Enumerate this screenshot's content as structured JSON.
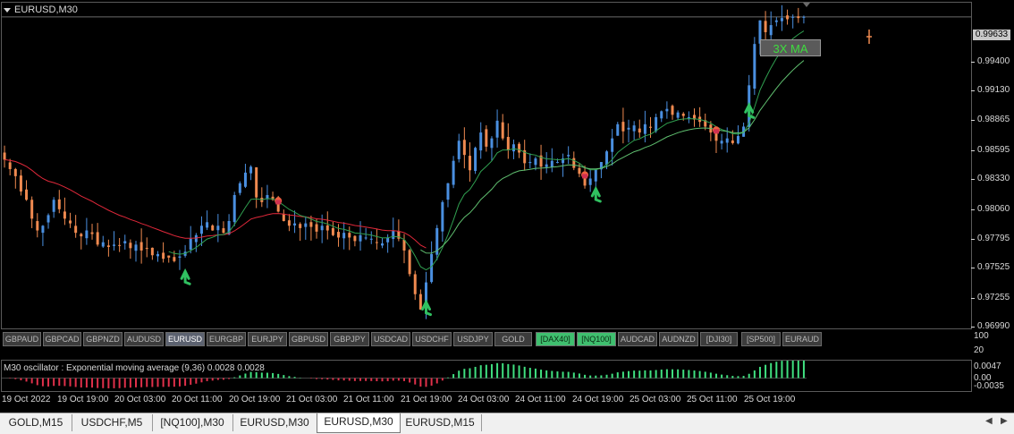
{
  "window": {
    "title": "EURUSD,M30"
  },
  "price_axis": {
    "ticks": [
      "0.99633",
      "0.99400",
      "0.99130",
      "0.98865",
      "0.98595",
      "0.98330",
      "0.98060",
      "0.97795",
      "0.97525",
      "0.97255",
      "0.96990"
    ],
    "current": "0.99633"
  },
  "ma_label": "3X MA",
  "symbol_bar": [
    {
      "label": "GBPAUD",
      "state": "normal"
    },
    {
      "label": "GBPCAD",
      "state": "normal"
    },
    {
      "label": "GBPNZD",
      "state": "normal"
    },
    {
      "label": "AUDUSD",
      "state": "normal"
    },
    {
      "label": "EURUSD",
      "state": "active"
    },
    {
      "label": "EURGBP",
      "state": "normal"
    },
    {
      "label": "EURJPY",
      "state": "normal"
    },
    {
      "label": "GBPUSD",
      "state": "normal"
    },
    {
      "label": "GBPJPY",
      "state": "normal"
    },
    {
      "label": "USDCAD",
      "state": "normal"
    },
    {
      "label": "USDCHF",
      "state": "normal"
    },
    {
      "label": "USDJPY",
      "state": "normal"
    },
    {
      "label": "GOLD",
      "state": "normal"
    },
    {
      "label": "[DAX40]",
      "state": "green"
    },
    {
      "label": "[NQ100]",
      "state": "green"
    },
    {
      "label": "AUDCAD",
      "state": "normal"
    },
    {
      "label": "AUDNZD",
      "state": "normal"
    },
    {
      "label": "[DJI30]",
      "state": "normal"
    },
    {
      "label": "[SP500]",
      "state": "normal"
    },
    {
      "label": "EURAUD",
      "state": "normal"
    }
  ],
  "indicator_axis": {
    "top": "100",
    "bottom": "20"
  },
  "oscillator": {
    "title": "M30  oscillator : Exponential moving average (9,36)  0.0028 0.0028",
    "axis": [
      "0.0047",
      "0.00",
      "-0.0035"
    ]
  },
  "time_axis": [
    "19 Oct 2022",
    "19 Oct 19:00",
    "20 Oct 03:00",
    "20 Oct 11:00",
    "20 Oct 19:00",
    "21 Oct 03:00",
    "21 Oct 11:00",
    "21 Oct 19:00",
    "24 Oct 03:00",
    "24 Oct 11:00",
    "24 Oct 19:00",
    "25 Oct 03:00",
    "25 Oct 11:00",
    "25 Oct 19:00"
  ],
  "tabs": [
    {
      "label": "GOLD,M15",
      "active": false
    },
    {
      "label": "USDCHF,M5",
      "active": false
    },
    {
      "label": "[NQ100],M30",
      "active": false
    },
    {
      "label": "EURUSD,M30",
      "active": false
    },
    {
      "label": "EURUSD,M30",
      "active": true
    },
    {
      "label": "EURUSD,M15",
      "active": false
    }
  ],
  "colors": {
    "bull": "#4a8fe0",
    "bear": "#f08a50",
    "ma_red": "#e0283a",
    "ma_green": "#30c060",
    "osc_pos": "#40e080",
    "osc_neg": "#e0304a"
  },
  "chart_data": {
    "type": "candlestick",
    "symbol": "EURUSD",
    "timeframe": "M30",
    "ylim": [
      0.9699,
      0.9975
    ],
    "closes": [
      0.9842,
      0.9834,
      0.9828,
      0.9815,
      0.9808,
      0.9792,
      0.9782,
      0.9786,
      0.9795,
      0.9808,
      0.98,
      0.9792,
      0.9788,
      0.978,
      0.9777,
      0.9782,
      0.9779,
      0.977,
      0.9772,
      0.9768,
      0.977,
      0.9769,
      0.9773,
      0.9767,
      0.977,
      0.9765,
      0.9767,
      0.9761,
      0.9762,
      0.9758,
      0.9759,
      0.9756,
      0.976,
      0.9764,
      0.9775,
      0.9778,
      0.9786,
      0.9789,
      0.9782,
      0.9786,
      0.978,
      0.979,
      0.9812,
      0.9822,
      0.9831,
      0.9836,
      0.981,
      0.9806,
      0.9812,
      0.9808,
      0.9798,
      0.979,
      0.9786,
      0.9788,
      0.9784,
      0.9788,
      0.9785,
      0.9781,
      0.9786,
      0.9782,
      0.9778,
      0.9776,
      0.978,
      0.9776,
      0.9773,
      0.9778,
      0.9776,
      0.9775,
      0.9772,
      0.9771,
      0.9776,
      0.9782,
      0.9775,
      0.9765,
      0.9745,
      0.9728,
      0.9715,
      0.9738,
      0.9762,
      0.9784,
      0.9806,
      0.9822,
      0.9841,
      0.9858,
      0.9846,
      0.9833,
      0.9852,
      0.9865,
      0.9853,
      0.986,
      0.9875,
      0.986,
      0.985,
      0.9855,
      0.9848,
      0.9839,
      0.984,
      0.9843,
      0.9836,
      0.9838,
      0.9841,
      0.984,
      0.9843,
      0.9846,
      0.9835,
      0.983,
      0.982,
      0.9826,
      0.9834,
      0.984,
      0.9849,
      0.986,
      0.9872,
      0.9866,
      0.9869,
      0.9871,
      0.9865,
      0.9872,
      0.9869,
      0.9878,
      0.9883,
      0.9885,
      0.988,
      0.9882,
      0.9879,
      0.9878,
      0.9876,
      0.9874,
      0.987,
      0.9865,
      0.9858,
      0.9858,
      0.986,
      0.9856,
      0.9862,
      0.987,
      0.9905,
      0.994,
      0.996,
      0.995,
      0.9956,
      0.996,
      0.9962,
      0.9961,
      0.9963,
      0.9962,
      0.9963
    ],
    "indicators": [
      "Moving Average (red)",
      "Moving Average (green)",
      "Moving Average (light green)"
    ],
    "oscillator_ylim": [
      -0.0035,
      0.0047
    ]
  }
}
